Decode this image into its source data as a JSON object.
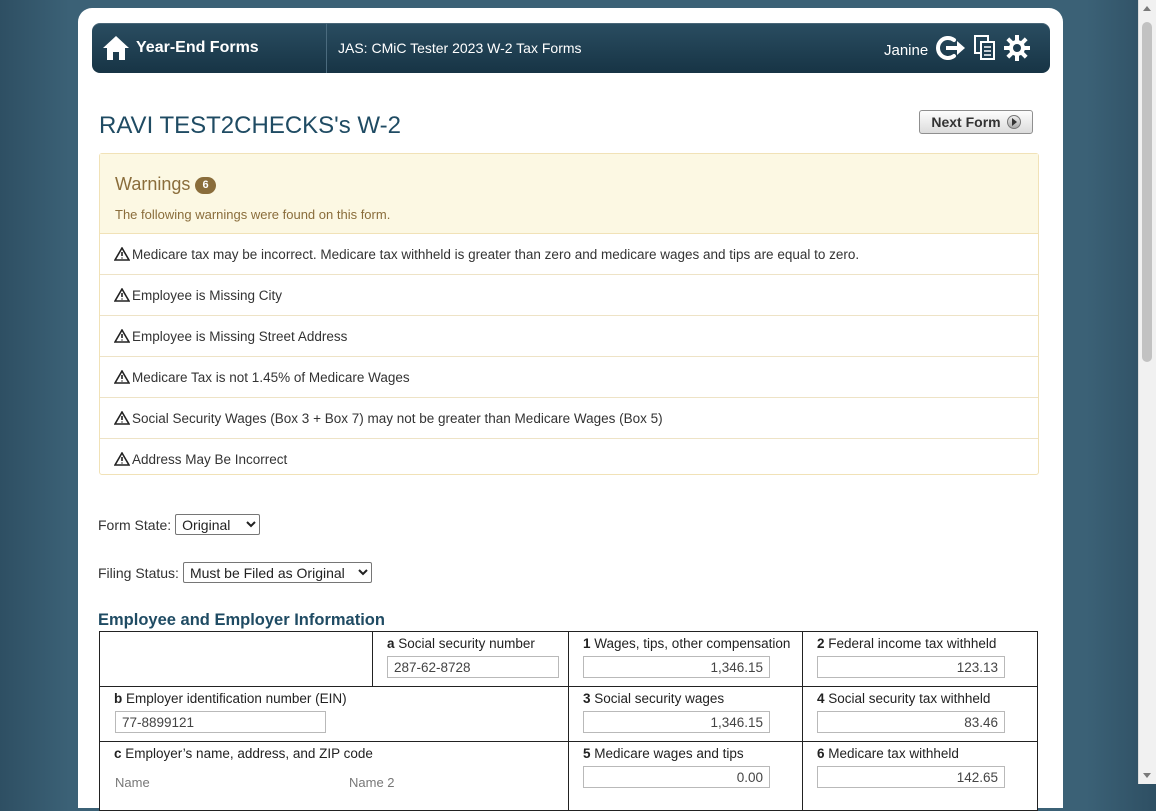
{
  "header": {
    "home_label": "Year-End Forms",
    "app_title": "JAS: CMiC Tester 2023 W-2 Tax Forms",
    "user_name": "Janine",
    "icons": [
      "home-icon",
      "logout-icon",
      "copy-icon",
      "gear-icon"
    ]
  },
  "form": {
    "title": "RAVI TEST2CHECKS's W-2",
    "next_button": "Next Form"
  },
  "warnings": {
    "title": "Warnings",
    "count": "6",
    "subtitle": "The following warnings were found on this form.",
    "items": [
      "Medicare tax may be incorrect. Medicare tax withheld is greater than zero and medicare wages and tips are equal to zero.",
      "Employee is Missing City",
      "Employee is Missing Street Address",
      "Medicare Tax is not 1.45% of Medicare Wages",
      "Social Security Wages (Box 3 + Box 7) may not be greater than Medicare Wages (Box 5)",
      "Address May Be Incorrect"
    ]
  },
  "form_state": {
    "label": "Form State:",
    "value": "Original"
  },
  "filing_status": {
    "label": "Filing Status:",
    "value": "Must be Filed as Original"
  },
  "section_title": "Employee and Employer Information",
  "w2": {
    "a": {
      "letter": "a",
      "label": "Social security number",
      "value": "287-62-8728"
    },
    "b": {
      "letter": "b",
      "label": "Employer identification number (EIN)",
      "value": "77-8899121"
    },
    "c": {
      "letter": "c",
      "label": "Employer’s name, address, and ZIP code",
      "name1": "Name",
      "name2": "Name 2"
    },
    "box1": {
      "num": "1",
      "label": "Wages, tips, other compensation",
      "value": "1,346.15"
    },
    "box2": {
      "num": "2",
      "label": "Federal income tax withheld",
      "value": "123.13"
    },
    "box3": {
      "num": "3",
      "label": "Social security wages",
      "value": "1,346.15"
    },
    "box4": {
      "num": "4",
      "label": "Social security tax withheld",
      "value": "83.46"
    },
    "box5": {
      "num": "5",
      "label": "Medicare wages and tips",
      "value": "0.00"
    },
    "box6": {
      "num": "6",
      "label": "Medicare tax withheld",
      "value": "142.65"
    }
  },
  "colors": {
    "header_bg": "#1e3d50",
    "title": "#1f4b63",
    "warning_bg": "#fcf8e3",
    "warning_text": "#8a6d3b"
  }
}
